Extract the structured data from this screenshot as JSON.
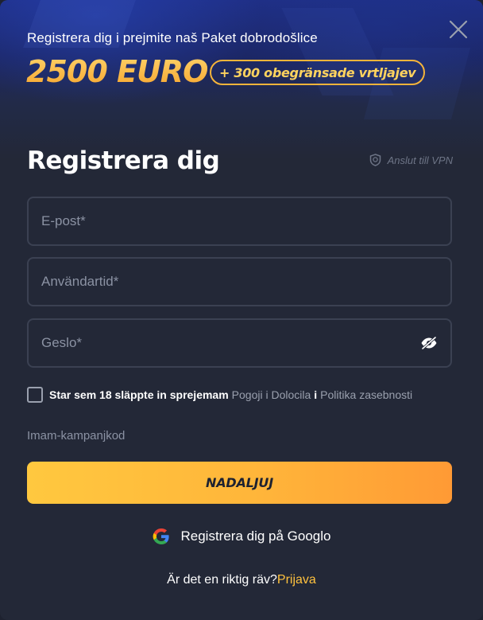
{
  "banner": {
    "promo_line": "Registrera dig i prejmite naš Paket dobrodošlice",
    "amount": "2500 EURO",
    "spins": "+ 300 obegränsade vrtljajev"
  },
  "form": {
    "title": "Registrera dig",
    "vpn_label": "Anslut till VPN",
    "email": {
      "placeholder": "E-post*",
      "value": ""
    },
    "username": {
      "placeholder": "Användartid*",
      "value": ""
    },
    "password": {
      "placeholder": "Geslo*",
      "value": ""
    },
    "terms": {
      "prefix": "Star sem 18 släppte in sprejemam",
      "terms_link": "Pogoji i Dolocila",
      "and": "i",
      "privacy_link": "Politika zasebnosti",
      "checked": false
    },
    "promo_code_label": "Imam-kampanjkod",
    "submit_label": "NADALJUJ",
    "google_label": "Registrera dig på Googlo",
    "login_prompt": "Är det en riktig räv?",
    "login_link": "Prijava"
  },
  "colors": {
    "accent": "#ffc23e",
    "background": "#232837",
    "field_border": "#3b4152"
  },
  "icons": {
    "close": "close-icon",
    "vpn": "shield-icon",
    "eye": "eye-hidden-icon",
    "google": "google-icon"
  }
}
